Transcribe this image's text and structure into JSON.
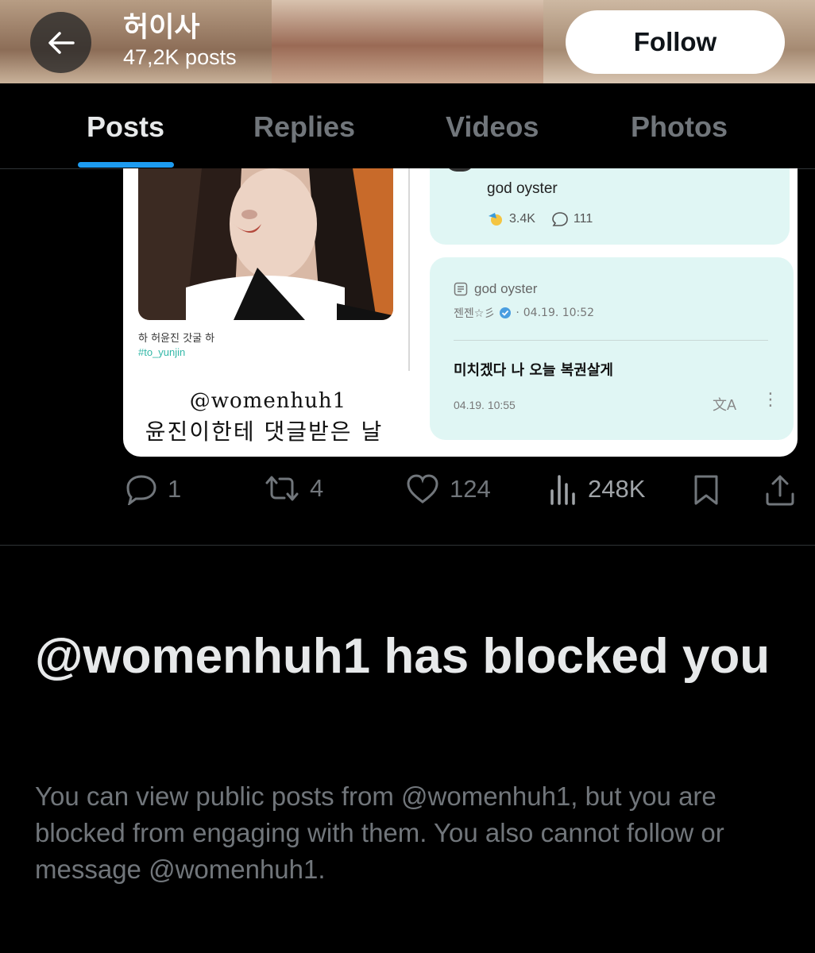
{
  "header": {
    "title": "허이사",
    "subtitle": "47,2K posts",
    "follow_label": "Follow"
  },
  "tabs": [
    {
      "label": "Posts",
      "active": true
    },
    {
      "label": "Replies",
      "active": false
    },
    {
      "label": "Videos",
      "active": false
    },
    {
      "label": "Photos",
      "active": false
    }
  ],
  "media": {
    "photo_caption": "하 허윤진 갓굴 하",
    "photo_hashtag": "#to_yunjin",
    "watermark_handle": "@womenhuh1",
    "watermark_caption": "윤진이한테 댓글받은 날",
    "card1": {
      "text": "god oyster",
      "reaction_count": "3.4K",
      "comment_count": "111"
    },
    "card2": {
      "source_title": "god oyster",
      "author": "젠젠☆彡",
      "posted_at": "04.19. 10:52",
      "body": "미치겠다 나 오늘 복권살게",
      "reply_time": "04.19. 10:55"
    }
  },
  "post_actions": {
    "replies": "1",
    "reposts": "4",
    "likes": "124",
    "views": "248K"
  },
  "block_notice": {
    "title": "@womenhuh1 has blocked you",
    "description": "You can view public posts from @womenhuh1, but you are blocked from engaging with them. You also cannot follow or message @womenhuh1."
  },
  "colors": {
    "accent": "#1d9bf0",
    "background": "#000000",
    "text_primary": "#e7e9ea",
    "text_secondary": "#71767b",
    "card_mint": "#e0f6f4",
    "hashtag_teal": "#33b8a8"
  },
  "icons": [
    "arrow-left-icon",
    "reply-icon",
    "repost-icon",
    "heart-icon",
    "views-icon",
    "bookmark-icon",
    "share-icon",
    "translate-icon",
    "more-icon",
    "verified-icon",
    "document-icon",
    "chat-bubble-icon"
  ]
}
